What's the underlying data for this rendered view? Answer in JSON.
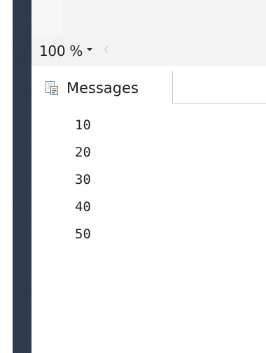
{
  "zoom": {
    "value": "100 %"
  },
  "results_tabs": {
    "messages_label": "Messages"
  },
  "messages": {
    "lines": [
      "10",
      "20",
      "30",
      "40",
      "50"
    ]
  }
}
